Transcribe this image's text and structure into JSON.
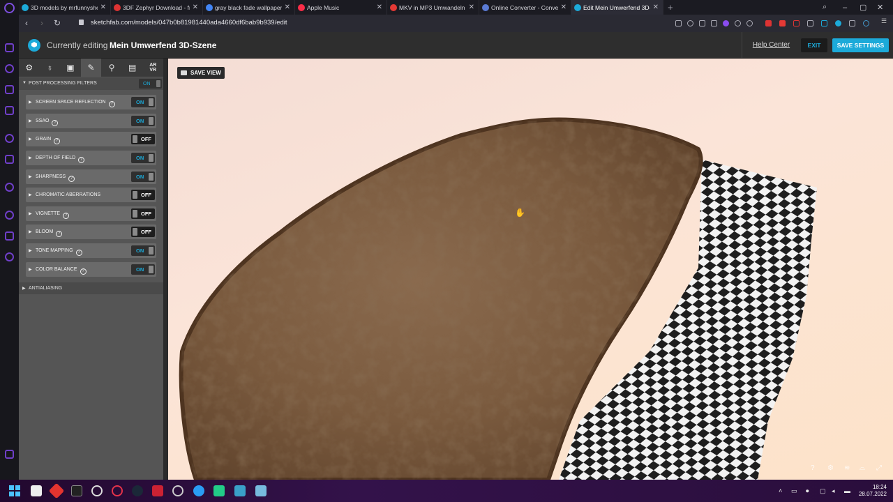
{
  "browser": {
    "tabs": [
      {
        "label": "3D models by mrfunnyshe",
        "color": "#1caad9"
      },
      {
        "label": "3DF Zephyr Download - fre",
        "color": "#d33"
      },
      {
        "label": "gray black fade wallpaper",
        "color": "#4285f4"
      },
      {
        "label": "Apple Music",
        "color": "#fa2d48"
      },
      {
        "label": "MKV in MP3 Umwandeln (f",
        "color": "#e53935"
      },
      {
        "label": "Online Converter - Conver",
        "color": "#5b7bd5"
      },
      {
        "label": "Edit Mein Umwerfend 3D-S",
        "color": "#1caad9",
        "active": true
      }
    ],
    "new_tab": "+",
    "close_glyph": "✕",
    "url": "sketchfab.com/models/047b0b81981440ada4660df6bab9b939/edit"
  },
  "header": {
    "editing_prefix": "Currently editing",
    "scene_name": "Mein Umwerfend 3D-Szene",
    "help_center": "Help Center",
    "exit": "EXIT",
    "save_settings": "SAVE SETTINGS"
  },
  "panel": {
    "tabs": [
      {
        "name": "settings",
        "icon": "gear-icon"
      },
      {
        "name": "lighting",
        "icon": "lightbulb-icon"
      },
      {
        "name": "materials",
        "icon": "image-icon"
      },
      {
        "name": "post-processing",
        "icon": "magic-wand-icon",
        "active": true
      },
      {
        "name": "annotations",
        "icon": "map-pin-icon"
      },
      {
        "name": "animation",
        "icon": "film-icon"
      },
      {
        "name": "ar-vr",
        "icon": "ar-vr-icon",
        "label_top": "AR",
        "label_bottom": "VR"
      }
    ],
    "section_title": "POST PROCESSING FILTERS",
    "section_toggle": "ON",
    "filters": [
      {
        "label": "SCREEN SPACE REFLECTION",
        "state": "ON"
      },
      {
        "label": "SSAO",
        "state": "ON"
      },
      {
        "label": "GRAIN",
        "state": "OFF"
      },
      {
        "label": "DEPTH OF FIELD",
        "state": "ON"
      },
      {
        "label": "SHARPNESS",
        "state": "ON"
      },
      {
        "label": "CHROMATIC ABERRATIONS",
        "state": "OFF",
        "no_help": true
      },
      {
        "label": "VIGNETTE",
        "state": "OFF"
      },
      {
        "label": "BLOOM",
        "state": "OFF"
      },
      {
        "label": "TONE MAPPING",
        "state": "ON"
      },
      {
        "label": "COLOR BALANCE",
        "state": "ON"
      }
    ],
    "antialiasing": "ANTIALIASING"
  },
  "viewport": {
    "save_view": "SAVE VIEW"
  },
  "taskbar": {
    "time": "18:24",
    "date": "28.07.2022"
  },
  "colors": {
    "accent": "#1caad9",
    "panel_bg": "#555555",
    "header_bg": "#2e2e2e"
  }
}
